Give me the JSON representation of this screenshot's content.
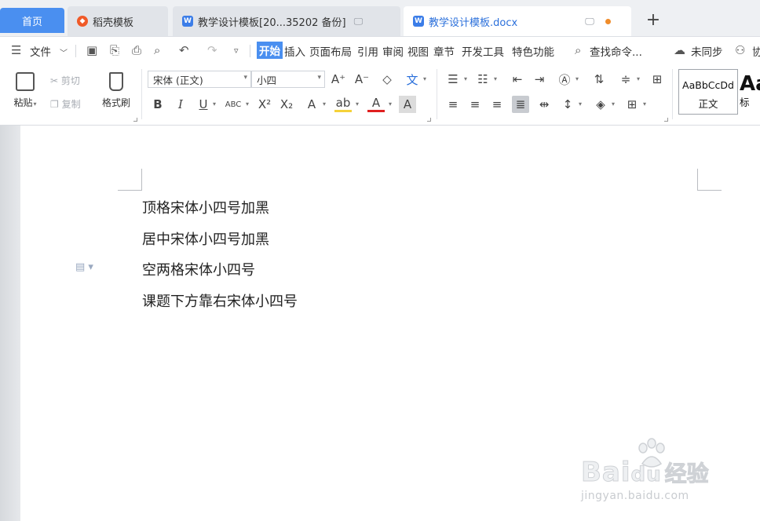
{
  "tabs": [
    {
      "label": "首页"
    },
    {
      "label": "稻壳模板"
    },
    {
      "label": "教学设计模板[20...35202 备份]"
    },
    {
      "label": "教学设计模板.docx"
    }
  ],
  "menu": {
    "file": "文件",
    "items": [
      "开始",
      "插入",
      "页面布局",
      "引用",
      "审阅",
      "视图",
      "章节",
      "开发工具",
      "特色功能"
    ],
    "search": "查找命令...",
    "sync": "未同步",
    "collab": "协"
  },
  "ribbon": {
    "paste": "粘贴",
    "cut": "剪切",
    "copy": "复制",
    "format_painter": "格式刷",
    "font_name": "宋体 (正文)",
    "font_size": "小四",
    "style_sample": "AaBbCcDd",
    "style_name": "正文",
    "style_sample2": "Aa",
    "style_name2": "标"
  },
  "document": {
    "lines": [
      "顶格宋体小四号加黑",
      "居中宋体小四号加黑",
      "空两格宋体小四号",
      "课题下方靠右宋体小四号"
    ]
  },
  "watermark": {
    "brand": "Bai",
    "brand_suffix": "du",
    "brand_cn": "经验",
    "site": "jingyan.baidu.com"
  }
}
